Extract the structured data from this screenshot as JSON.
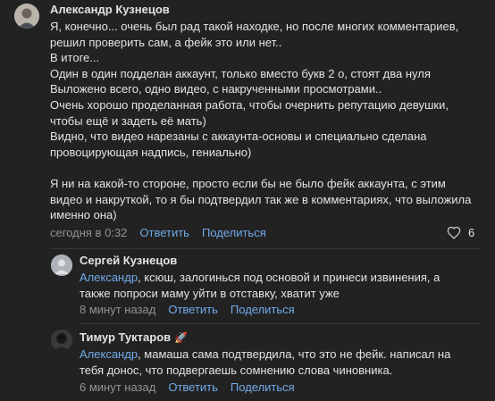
{
  "comments": [
    {
      "author": "Александр Кузнецов",
      "text": "Я, конечно... очень был рад такой находке, но после многих комментариев, решил проверить сам, а фейк это или нет..\nВ итоге...\nОдин в один подделан аккаунт, только вместо букв 2 о, стоят два нуля\nВыложено всего, одно видео, с накрученными просмотрами..\nОчень хорошо проделанная работа, чтобы очернить репутацию девушки, чтобы ещё и задеть её мать)\nВидно, что видео нарезаны с аккаунта-основы и специально сделана провоцирующая надпись, гениально)\n\nЯ ни на какой-то стороне, просто если бы не было фейк аккаунта, с этим видео и накруткой, то я бы подтвердил так же в комментариях, что выложила именно она)",
      "time": "сегодня в 0:32",
      "reply_label": "Ответить",
      "share_label": "Поделиться",
      "likes": "6"
    }
  ],
  "replies": [
    {
      "author": "Сергей Кузнецов",
      "mention": "Александр",
      "text": ", ксюш, залогинься под основой и принеси извинения, а также попроси маму уйти в отставку, хватит уже",
      "time": "8 минут назад",
      "reply_label": "Ответить",
      "share_label": "Поделиться"
    },
    {
      "author": "Тимур Туктаров",
      "author_badge": "rocket-icon",
      "mention": "Александр",
      "text": ", мамаша сама подтвердила, что это не фейк. написал на тебя донос, что подвергаешь сомнению слова чиновника.",
      "time": "6 минут назад",
      "reply_label": "Ответить",
      "share_label": "Поделиться"
    }
  ],
  "colors": {
    "background": "#222222",
    "text": "#e1e3e6",
    "link": "#71aaeb",
    "meta": "#939393"
  }
}
